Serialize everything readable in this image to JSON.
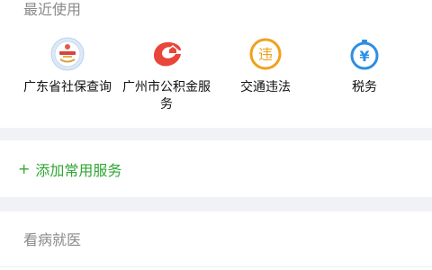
{
  "recent": {
    "title": "最近使用",
    "items": [
      {
        "label": "广东省社保查询",
        "icon": "social-security-seal-icon"
      },
      {
        "label": "广州市公积金服务",
        "icon": "housing-fund-logo-icon"
      },
      {
        "label": "交通违法",
        "icon": "traffic-violation-icon"
      },
      {
        "label": "税务",
        "icon": "tax-yen-icon"
      }
    ]
  },
  "add_service": {
    "plus": "+",
    "label": "添加常用服务"
  },
  "health": {
    "title": "看病就医"
  },
  "colors": {
    "accent_green": "#2fa632",
    "orange": "#f0a11c",
    "blue": "#2d8fe2",
    "red": "#e9453a",
    "muted_text": "#8a8a8a",
    "separator": "#f1f2f6"
  }
}
